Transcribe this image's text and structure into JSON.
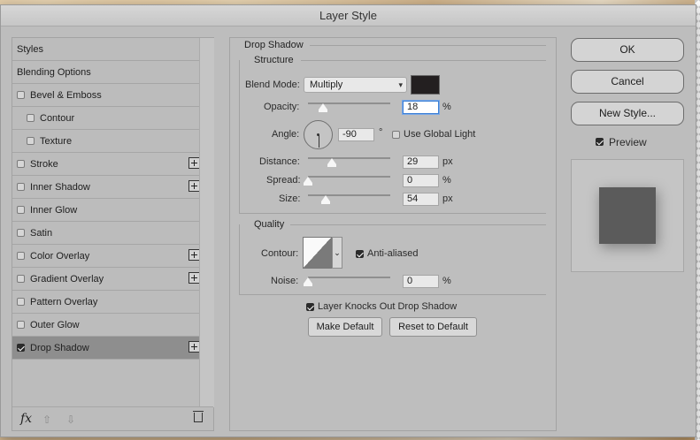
{
  "window": {
    "title": "Layer Style"
  },
  "styles_list": {
    "items": [
      {
        "label": "Styles",
        "checkbox": false,
        "checked": false,
        "indent": 0,
        "plus": false,
        "active": false
      },
      {
        "label": "Blending Options",
        "checkbox": false,
        "checked": false,
        "indent": 0,
        "plus": false,
        "active": false
      },
      {
        "label": "Bevel & Emboss",
        "checkbox": true,
        "checked": false,
        "indent": 0,
        "plus": false,
        "active": false
      },
      {
        "label": "Contour",
        "checkbox": true,
        "checked": false,
        "indent": 1,
        "plus": false,
        "active": false
      },
      {
        "label": "Texture",
        "checkbox": true,
        "checked": false,
        "indent": 1,
        "plus": false,
        "active": false
      },
      {
        "label": "Stroke",
        "checkbox": true,
        "checked": false,
        "indent": 0,
        "plus": true,
        "active": false
      },
      {
        "label": "Inner Shadow",
        "checkbox": true,
        "checked": false,
        "indent": 0,
        "plus": true,
        "active": false
      },
      {
        "label": "Inner Glow",
        "checkbox": true,
        "checked": false,
        "indent": 0,
        "plus": false,
        "active": false
      },
      {
        "label": "Satin",
        "checkbox": true,
        "checked": false,
        "indent": 0,
        "plus": false,
        "active": false
      },
      {
        "label": "Color Overlay",
        "checkbox": true,
        "checked": false,
        "indent": 0,
        "plus": true,
        "active": false
      },
      {
        "label": "Gradient Overlay",
        "checkbox": true,
        "checked": false,
        "indent": 0,
        "plus": true,
        "active": false
      },
      {
        "label": "Pattern Overlay",
        "checkbox": true,
        "checked": false,
        "indent": 0,
        "plus": false,
        "active": false
      },
      {
        "label": "Outer Glow",
        "checkbox": true,
        "checked": false,
        "indent": 0,
        "plus": false,
        "active": false
      },
      {
        "label": "Drop Shadow",
        "checkbox": true,
        "checked": true,
        "indent": 0,
        "plus": true,
        "active": true
      }
    ],
    "footer": {
      "fx_label": "fx",
      "up_arrow": "⇧",
      "down_arrow": "⇩"
    }
  },
  "drop_shadow": {
    "section_title": "Drop Shadow",
    "structure": {
      "title": "Structure",
      "blend_mode_label": "Blend Mode:",
      "blend_mode_value": "Multiply",
      "shadow_color": "#231f20",
      "opacity_label": "Opacity:",
      "opacity_value": "18",
      "opacity_unit": "%",
      "opacity_level": 0.18,
      "angle_label": "Angle:",
      "angle_value": "-90",
      "angle_unit": "°",
      "use_global_light_label": "Use Global Light",
      "use_global_light_checked": false,
      "distance_label": "Distance:",
      "distance_value": "29",
      "distance_unit": "px",
      "distance_level": 0.29,
      "spread_label": "Spread:",
      "spread_value": "0",
      "spread_unit": "%",
      "spread_level": 0,
      "size_label": "Size:",
      "size_value": "54",
      "size_unit": "px",
      "size_level": 0.22
    },
    "quality": {
      "title": "Quality",
      "contour_label": "Contour:",
      "anti_aliased_label": "Anti-aliased",
      "anti_aliased_checked": true,
      "noise_label": "Noise:",
      "noise_value": "0",
      "noise_unit": "%",
      "noise_level": 0
    },
    "knocks_out_label": "Layer Knocks Out Drop Shadow",
    "knocks_out_checked": true,
    "make_default_label": "Make Default",
    "reset_default_label": "Reset to Default"
  },
  "actions": {
    "ok_label": "OK",
    "cancel_label": "Cancel",
    "new_style_label": "New Style...",
    "preview_label": "Preview",
    "preview_checked": true
  }
}
